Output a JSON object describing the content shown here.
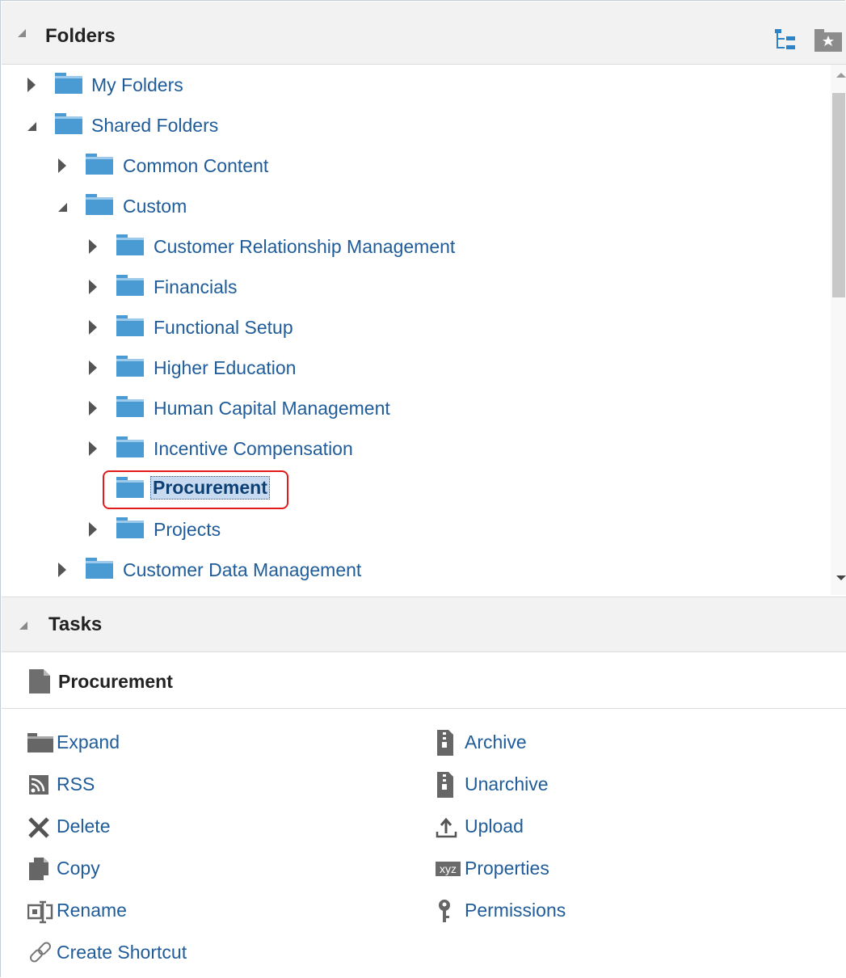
{
  "folders_panel": {
    "title": "Folders"
  },
  "tree": {
    "my_folders": "My Folders",
    "shared_folders": "Shared Folders",
    "common_content": "Common Content",
    "custom": "Custom",
    "crm": "Customer Relationship Management",
    "financials": "Financials",
    "functional_setup": "Functional Setup",
    "higher_education": "Higher Education",
    "hcm": "Human Capital Management",
    "incentive": "Incentive Compensation",
    "procurement": "Procurement",
    "projects": "Projects",
    "customer_data": "Customer Data Management"
  },
  "tasks_panel": {
    "title": "Tasks",
    "selected_item": "Procurement",
    "left": {
      "expand": "Expand",
      "rss": "RSS",
      "delete": "Delete",
      "copy": "Copy",
      "rename": "Rename",
      "create_shortcut": "Create Shortcut"
    },
    "right": {
      "archive": "Archive",
      "unarchive": "Unarchive",
      "upload": "Upload",
      "properties": "Properties",
      "permissions": "Permissions"
    },
    "properties_icon_text": "xyz"
  },
  "colors": {
    "folder_blue": "#4a9ad4",
    "link_blue": "#1f5c99",
    "highlight": "#e21a1a"
  }
}
